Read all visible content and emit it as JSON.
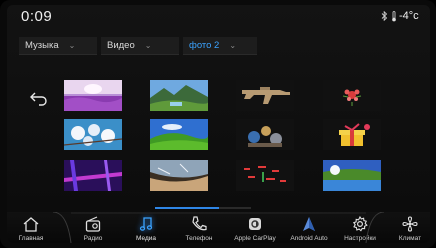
{
  "status": {
    "time": "0:09",
    "temperature": "-4°c"
  },
  "filters": [
    {
      "label": "Музыка"
    },
    {
      "label": "Видео"
    },
    {
      "label": "фото 2"
    }
  ],
  "scroll": {
    "position_fraction": 0.67
  },
  "nav": [
    {
      "label": "Главная",
      "icon": "home-icon"
    },
    {
      "label": "Радио",
      "icon": "radio-icon"
    },
    {
      "label": "Медиа",
      "icon": "music-note-icon"
    },
    {
      "label": "Телефон",
      "icon": "phone-icon"
    },
    {
      "label": "Apple CarPlay",
      "icon": "carplay-icon"
    },
    {
      "label": "Android Auto",
      "icon": "android-auto-icon"
    },
    {
      "label": "Настройки",
      "icon": "gear-icon"
    },
    {
      "label": "Климат",
      "icon": "fan-icon"
    }
  ],
  "colors": {
    "accent": "#2f86e6",
    "active_text": "#3ba3ff"
  }
}
